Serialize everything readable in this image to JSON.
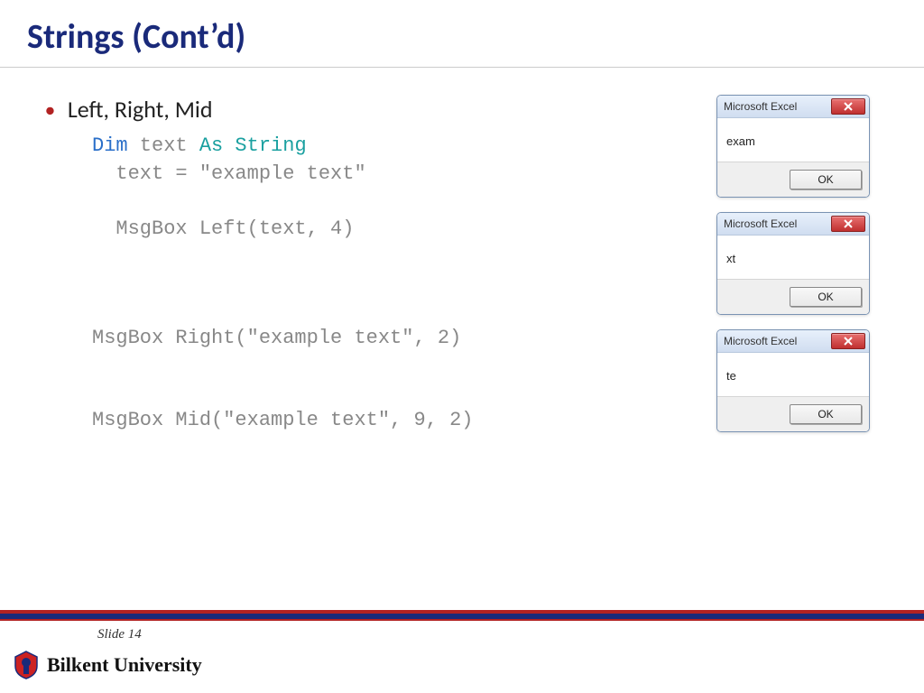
{
  "title": "Strings (Cont’d)",
  "bullet": "Left, Right, Mid",
  "code": {
    "dim": "Dim",
    "text_var": " text ",
    "as_string": "As String",
    "assign": "  text = \"example text\"",
    "left_line": "  MsgBox Left(text, 4)",
    "right_line": "MsgBox Right(\"example text\", 2)",
    "mid_line": "MsgBox Mid(\"example text\", 9, 2)"
  },
  "msgboxes": [
    {
      "title": "Microsoft Excel",
      "body": "exam",
      "ok": "OK"
    },
    {
      "title": "Microsoft Excel",
      "body": "xt",
      "ok": "OK"
    },
    {
      "title": "Microsoft Excel",
      "body": "te",
      "ok": "OK"
    }
  ],
  "slide_number": "Slide 14",
  "university": "Bilkent University"
}
